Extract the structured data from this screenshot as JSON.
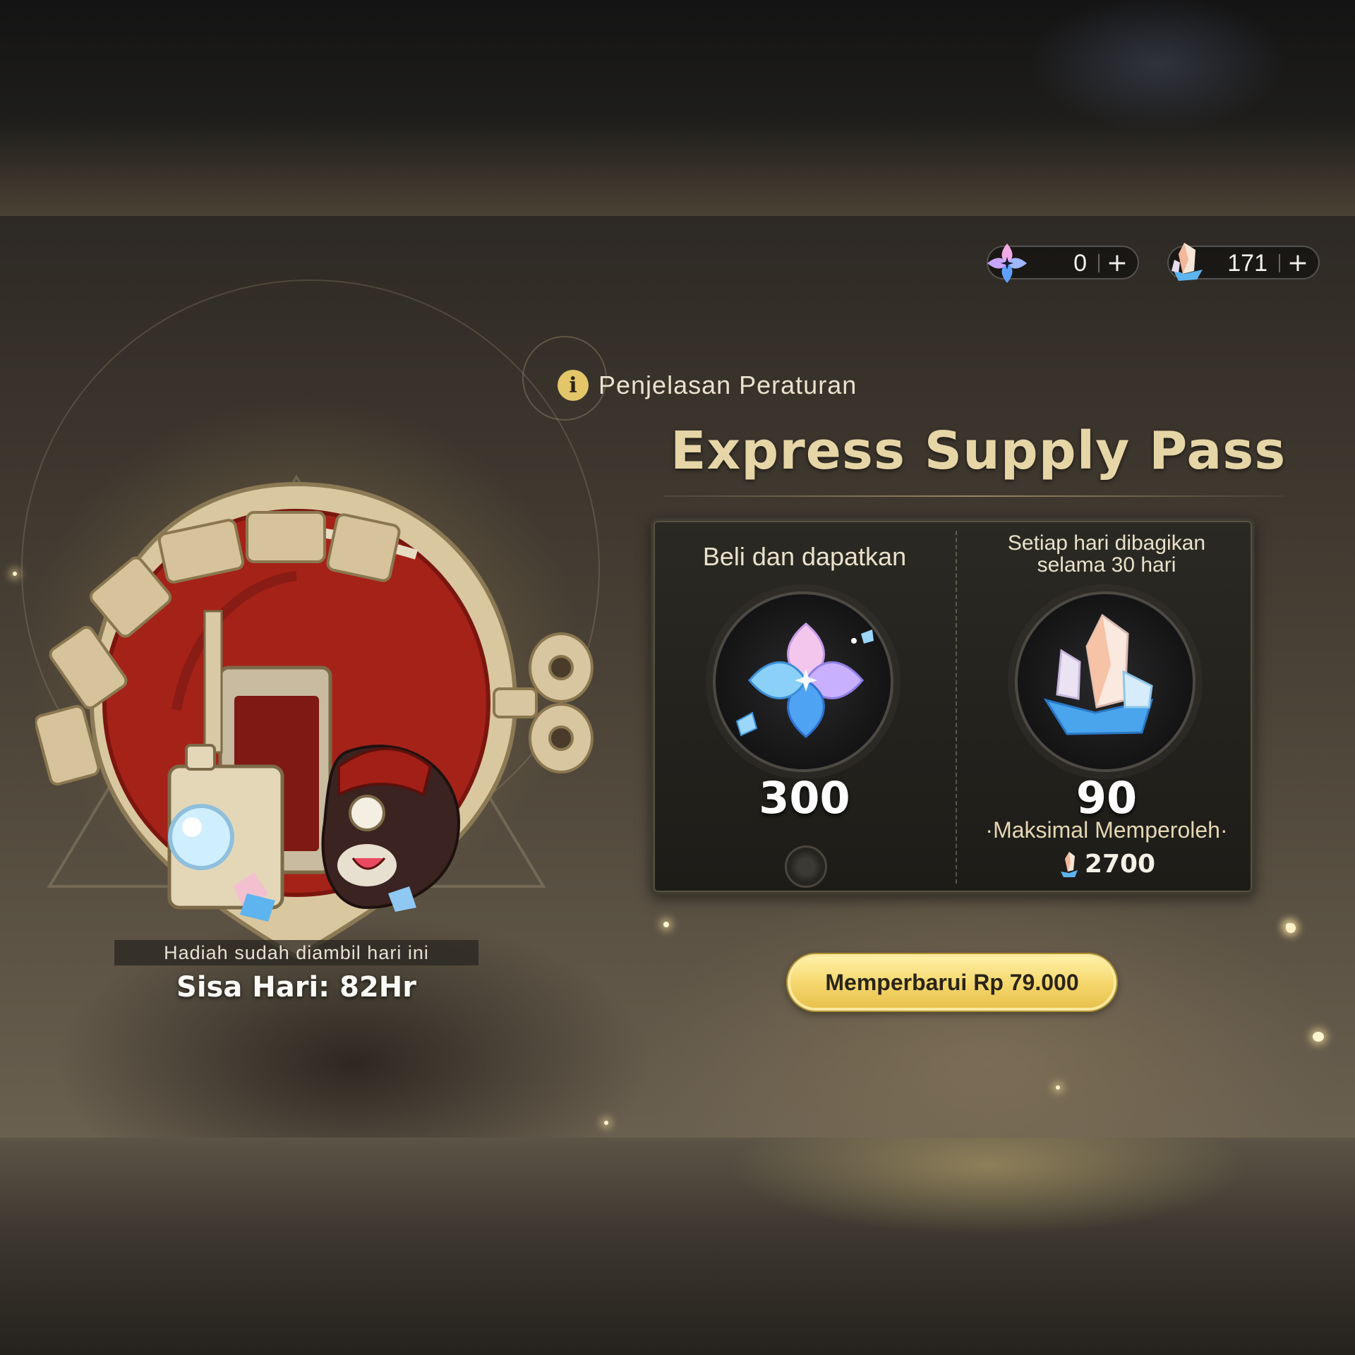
{
  "currency": {
    "stellar_jade": {
      "icon": "stellar-jade-icon",
      "value": "0",
      "plus": "+"
    },
    "oneiric_shard": {
      "icon": "oneiric-shard-icon",
      "value": "171",
      "plus": "+"
    }
  },
  "rules": {
    "label": "Penjelasan Peraturan",
    "icon_text": "i"
  },
  "pass": {
    "title": "Express Supply Pass"
  },
  "rewards": {
    "instant": {
      "heading": "Beli dan dapatkan",
      "amount": "300",
      "icon": "oneiric-shard-flower-icon"
    },
    "daily": {
      "heading_line1": "Setiap hari dibagikan",
      "heading_line2": "selama 30 hari",
      "amount": "90",
      "icon": "stellar-jade-crystal-icon",
      "max_label": "·Maksimal Memperoleh·",
      "max_value": "2700"
    }
  },
  "renew": {
    "label": "Memperbarui Rp 79.000"
  },
  "status": {
    "claimed": "Hadiah sudah diambil hari ini",
    "days_left": "Sisa Hari: 82Hr"
  },
  "colors": {
    "accent_gold": "#e6d5a6",
    "button_gold": "#f4d66a",
    "emblem_red": "#b02418"
  }
}
